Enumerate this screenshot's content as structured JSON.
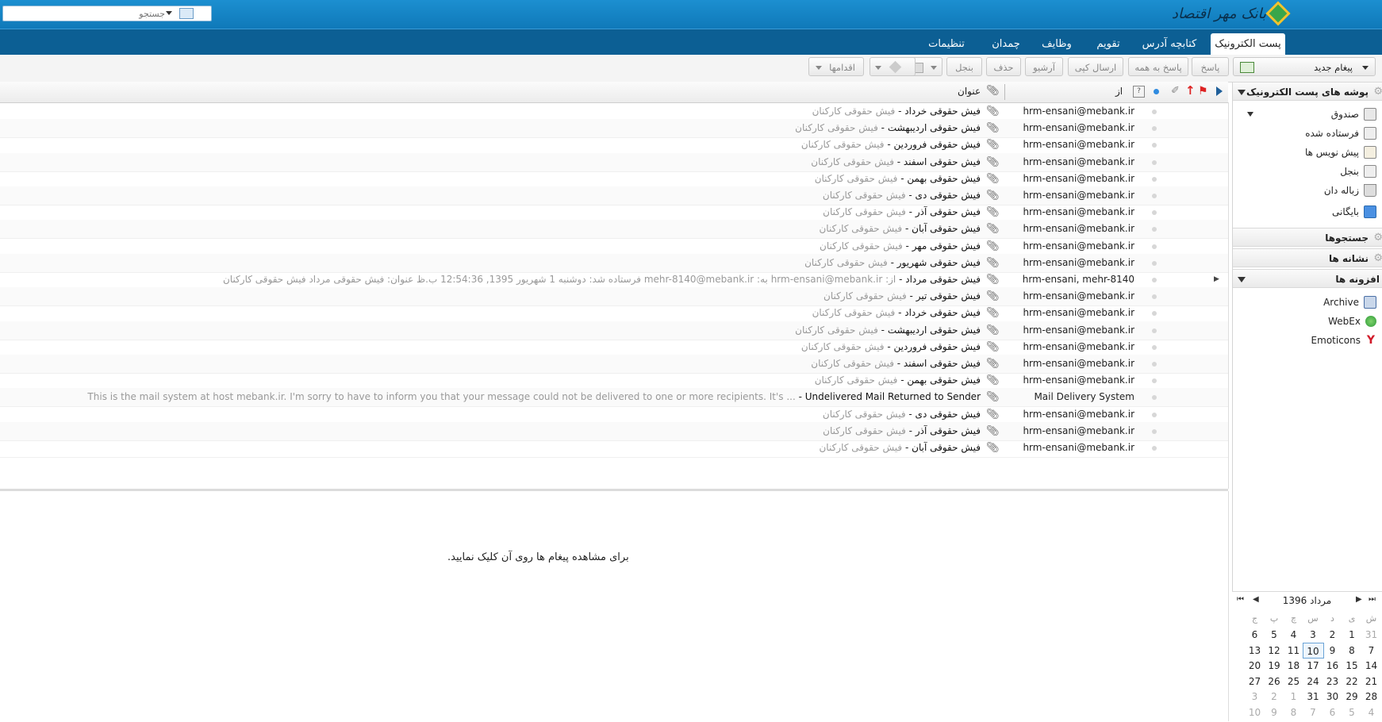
{
  "header": {
    "logo_text": "بانک مهر اقتصاد",
    "search_placeholder": "جستجو"
  },
  "tabs": [
    "پست الکترونیک",
    "کتابچه آدرس",
    "تقویم",
    "وظایف",
    "چمدان",
    "تنظیمات"
  ],
  "toolbar": {
    "new_message": "پیغام جدید",
    "reply": "پاسخ",
    "reply_all": "پاسخ به همه",
    "forward": "ارسال کپی",
    "archive": "آرشیو",
    "delete": "حذف",
    "junk": "بنجل",
    "actions": "اقدامها"
  },
  "list_header": {
    "from": "از",
    "subject": "عنوان"
  },
  "messages": [
    {
      "from": "hrm-ensani@mebank.ir",
      "subject": "فیش حقوقی خرداد",
      "snippet": "فیش حقوقی کارکنان"
    },
    {
      "from": "hrm-ensani@mebank.ir",
      "subject": "فیش حقوقی اردیبهشت",
      "snippet": "فیش حقوقی کارکنان"
    },
    {
      "from": "hrm-ensani@mebank.ir",
      "subject": "فیش حقوقی فروردین",
      "snippet": "فیش حقوقی کارکنان"
    },
    {
      "from": "hrm-ensani@mebank.ir",
      "subject": "فیش حقوقی اسفند",
      "snippet": "فیش حقوقی کارکنان"
    },
    {
      "from": "hrm-ensani@mebank.ir",
      "subject": "فیش حقوقی بهمن",
      "snippet": "فیش حقوقی کارکنان"
    },
    {
      "from": "hrm-ensani@mebank.ir",
      "subject": "فیش حقوقی دی",
      "snippet": "فیش حقوقی کارکنان"
    },
    {
      "from": "hrm-ensani@mebank.ir",
      "subject": "فیش حقوقی آذر",
      "snippet": "فیش حقوقی کارکنان"
    },
    {
      "from": "hrm-ensani@mebank.ir",
      "subject": "فیش حقوقی آبان",
      "snippet": "فیش حقوقی کارکنان"
    },
    {
      "from": "hrm-ensani@mebank.ir",
      "subject": "فیش حقوقی مهر",
      "snippet": "فیش حقوقی کارکنان"
    },
    {
      "from": "hrm-ensani@mebank.ir",
      "subject": "فیش حقوقی شهریور",
      "snippet": "فیش حقوقی کارکنان"
    },
    {
      "from": "hrm-ensani, mehr-8140",
      "subject": "فیش حقوقی مرداد",
      "snippet": "از: hrm-ensani@mebank.ir به: mehr-8140@mebank.ir فرستاده شد: دوشنبه 1 شهریور 1395, 12:54:36 ب.ظ عنوان: فیش حقوقی مرداد فیش حقوقی کارکنان",
      "thread": true
    },
    {
      "from": "hrm-ensani@mebank.ir",
      "subject": "فیش حقوقی تیر",
      "snippet": "فیش حقوقی کارکنان"
    },
    {
      "from": "hrm-ensani@mebank.ir",
      "subject": "فیش حقوقی خرداد",
      "snippet": "فیش حقوقی کارکنان"
    },
    {
      "from": "hrm-ensani@mebank.ir",
      "subject": "فیش حقوقی اردیبهشت",
      "snippet": "فیش حقوقی کارکنان"
    },
    {
      "from": "hrm-ensani@mebank.ir",
      "subject": "فیش حقوقی فروردین",
      "snippet": "فیش حقوقی کارکنان"
    },
    {
      "from": "hrm-ensani@mebank.ir",
      "subject": "فیش حقوقی اسفند",
      "snippet": "فیش حقوقی کارکنان"
    },
    {
      "from": "hrm-ensani@mebank.ir",
      "subject": "فیش حقوقی بهمن",
      "snippet": "فیش حقوقی کارکنان"
    },
    {
      "from": "Mail Delivery System",
      "subject": "Undelivered Mail Returned to Sender",
      "snippet": "This is the mail system at host mebank.ir. I'm sorry to have to inform you that your message could not be delivered to one or more recipients. It's ...",
      "ltr": true
    },
    {
      "from": "hrm-ensani@mebank.ir",
      "subject": "فیش حقوقی دی",
      "snippet": "فیش حقوقی کارکنان"
    },
    {
      "from": "hrm-ensani@mebank.ir",
      "subject": "فیش حقوقی آذر",
      "snippet": "فیش حقوقی کارکنان"
    },
    {
      "from": "hrm-ensani@mebank.ir",
      "subject": "فیش حقوقی آبان",
      "snippet": "فیش حقوقی کارکنان"
    }
  ],
  "preview_message": "برای مشاهده پیغام ها روی آن کلیک نمایید.",
  "sidebar": {
    "mail_folders_title": "پوشه های پست الکترونیک",
    "folders": [
      {
        "label": "صندوق",
        "icon": "inbox-icon"
      },
      {
        "label": "فرستاده شده",
        "icon": "sent-icon"
      },
      {
        "label": "پیش نویس ها",
        "icon": "drafts-icon"
      },
      {
        "label": "بنجل",
        "icon": "junk-icon"
      },
      {
        "label": "زباله دان",
        "icon": "trash-icon"
      },
      {
        "label": "بایگانی",
        "icon": "archive-folder-icon"
      }
    ],
    "searches_title": "جستجوها",
    "tags_title": "نشانه ها",
    "zimlets_title": "افزونه ها",
    "zimlets": [
      {
        "label": "Archive",
        "icon": "archive-zimlet-icon",
        "color": "#4a6fa5"
      },
      {
        "label": "WebEx",
        "icon": "webex-icon",
        "color": "#2f9a3a"
      },
      {
        "label": "Emoticons",
        "icon": "yahoo-emoticon-icon",
        "color": "#d11b2a"
      }
    ]
  },
  "calendar": {
    "title": "مرداد 1396",
    "weekdays": [
      "ش",
      "ی",
      "د",
      "س",
      "چ",
      "پ",
      "ج"
    ],
    "weeks": [
      [
        "31",
        "1",
        "2",
        "3",
        "4",
        "5",
        "6"
      ],
      [
        "7",
        "8",
        "9",
        "10",
        "11",
        "12",
        "13"
      ],
      [
        "14",
        "15",
        "16",
        "17",
        "18",
        "19",
        "20"
      ],
      [
        "21",
        "22",
        "23",
        "24",
        "25",
        "26",
        "27"
      ],
      [
        "28",
        "29",
        "30",
        "31",
        "1",
        "2",
        "3"
      ],
      [
        "4",
        "5",
        "6",
        "7",
        "8",
        "9",
        "10"
      ]
    ],
    "today": "10"
  },
  "colors": {
    "header": "#1285c7",
    "tabbar": "#0c5f94",
    "flag": "#d22"
  }
}
